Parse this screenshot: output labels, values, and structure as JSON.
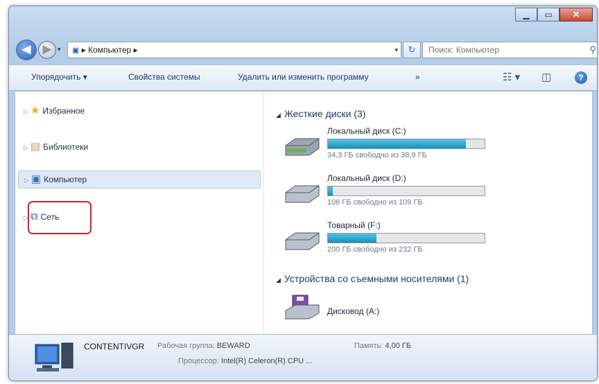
{
  "window": {
    "title_buttons": {
      "minimize": "▁",
      "maximize": "▭",
      "close": "✕"
    }
  },
  "address": {
    "breadcrumb_root": "▸",
    "breadcrumb": "Компьютер",
    "separator": "▸",
    "history_dropdown": "▾",
    "dropdown": "▾",
    "search_placeholder": "Поиск: Компьютер"
  },
  "toolbar": {
    "organize": "Упорядочить ▾",
    "system_properties": "Свойства системы",
    "uninstall": "Удалить или изменить программу",
    "more": "»",
    "view_icon": "view-options-icon",
    "preview_icon": "preview-pane-icon",
    "help_label": "?"
  },
  "navigation": {
    "items": [
      {
        "label": "Избранное",
        "icon": "star-icon"
      },
      {
        "label": "Библиотеки",
        "icon": "library-icon"
      },
      {
        "label": "Компьютер",
        "icon": "computer-icon"
      },
      {
        "label": "Сеть",
        "icon": "network-icon"
      }
    ]
  },
  "groups": {
    "hdd": "Жесткие диски (3)",
    "removable": "Устройства со съемными носителями (1)"
  },
  "drives": [
    {
      "name": "Локальный диск (C:)",
      "free_text": "34,3 ГБ свободно из 38,9 ГБ",
      "used_percent": 88
    },
    {
      "name": "Локальный диск (D:)",
      "free_text": "106 ГБ свободно из 109 ГБ",
      "used_percent": 3
    },
    {
      "name": "Товарный (F:)",
      "free_text": "200 ГБ свободно из 232 ГБ",
      "used_percent": 31
    }
  ],
  "removable": [
    {
      "name": "Дисковод (A:)"
    }
  ],
  "status": {
    "computer_name": "CONTENTIVGR",
    "workgroup_label": "Рабочая группа:",
    "workgroup": "BEWARD",
    "memory_label": "Память:",
    "memory": "4,00 ГБ",
    "cpu_label": "Процессор:",
    "cpu": "Intel(R) Celeron(R) CPU ..."
  },
  "colors": {
    "highlight": "#d81f26",
    "progress": "#1d8fb8"
  }
}
